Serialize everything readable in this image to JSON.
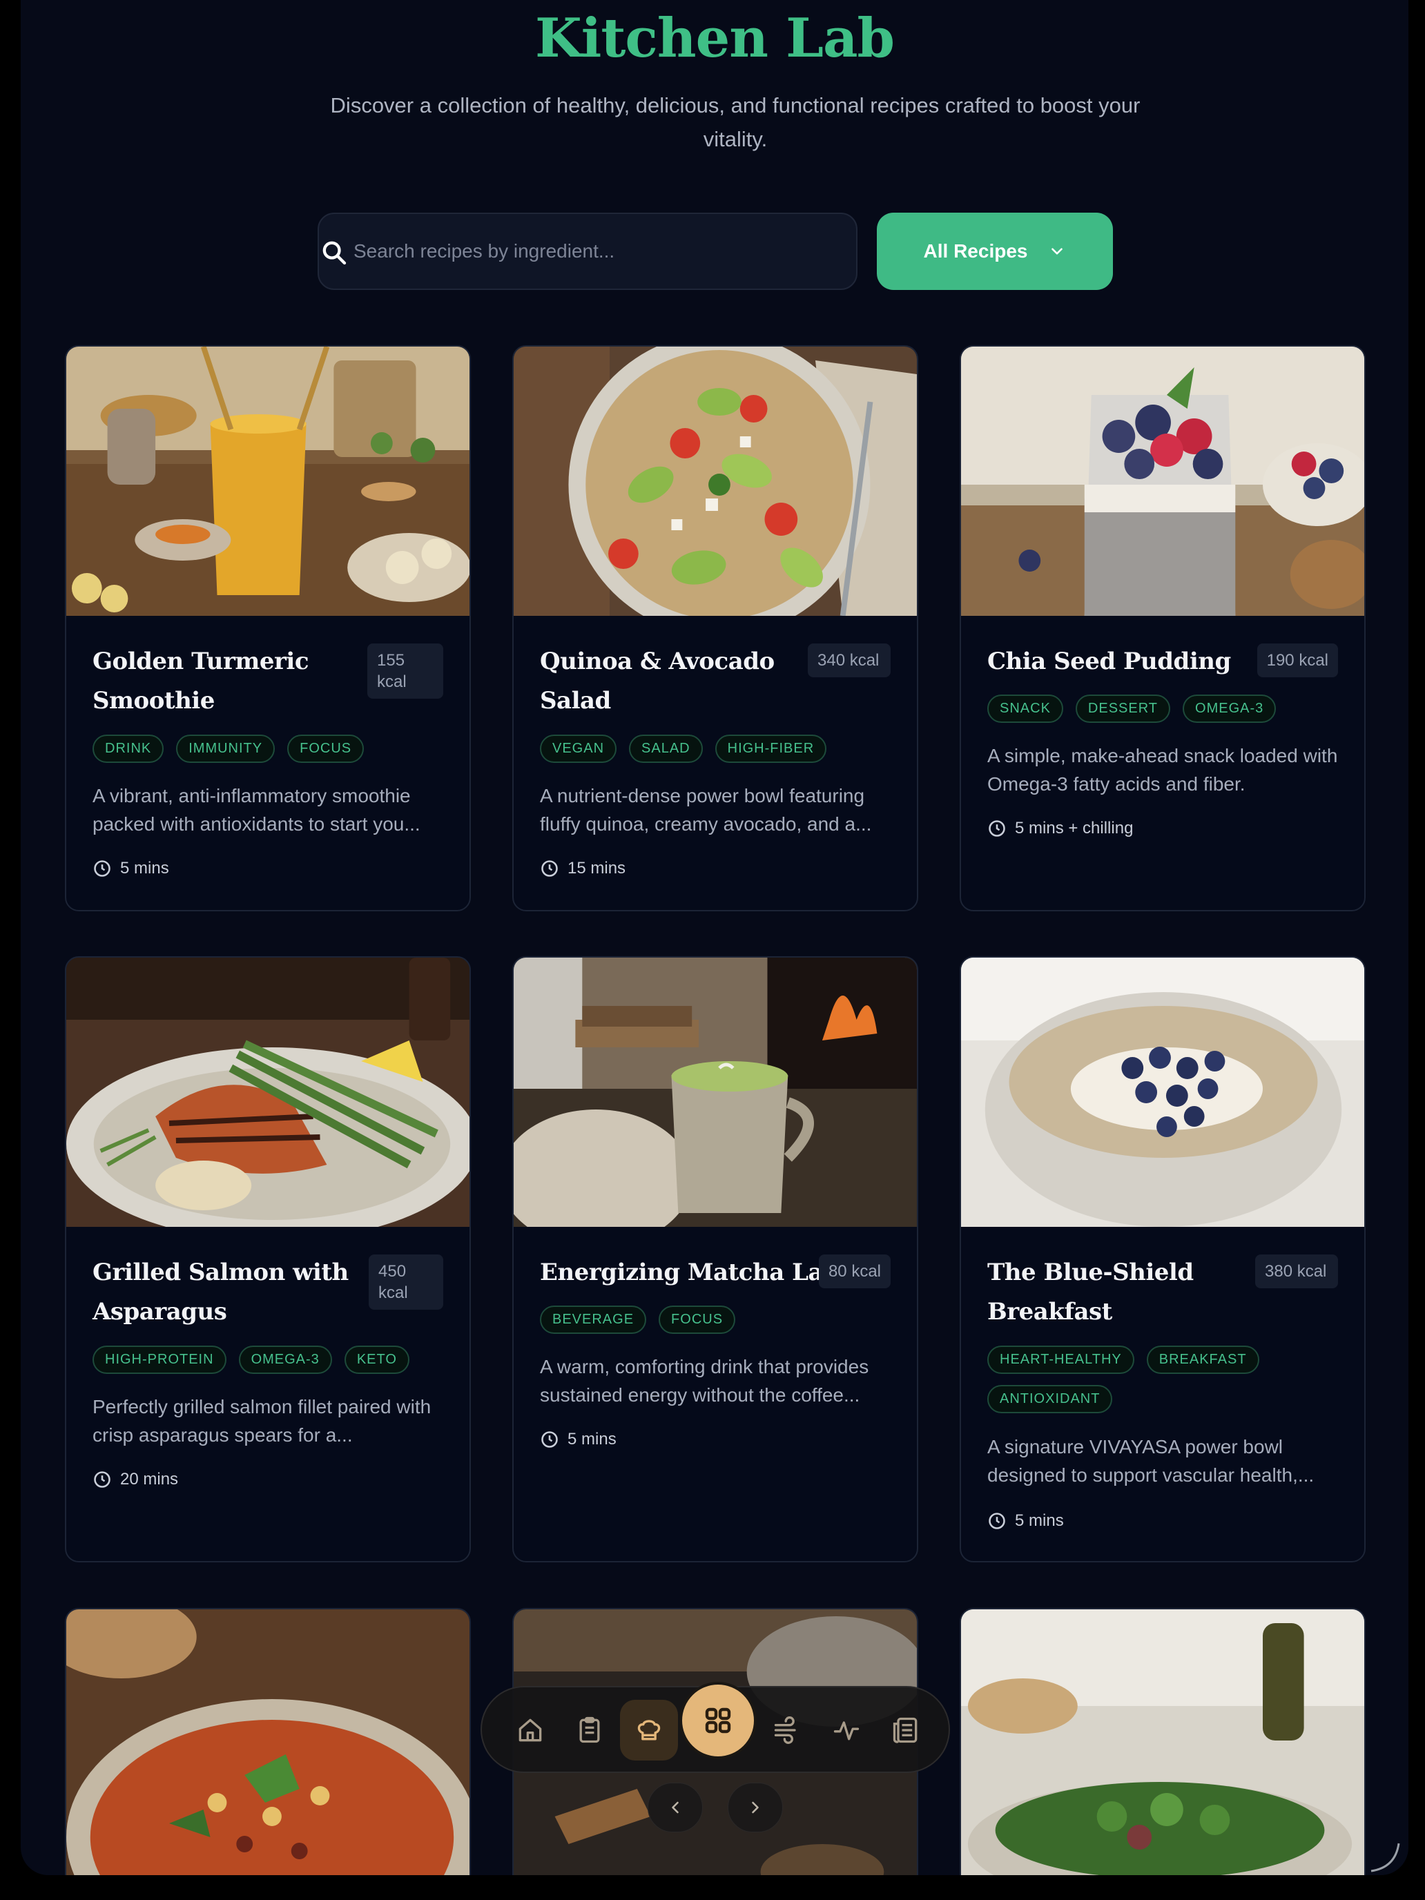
{
  "header": {
    "title": "Kitchen Lab",
    "subtitle": "Discover a collection of healthy, delicious, and functional recipes crafted to boost your vitality."
  },
  "search": {
    "placeholder": "Search recipes by ingredient...",
    "value": ""
  },
  "filter": {
    "label": "All Recipes"
  },
  "recipes": [
    {
      "title": "Golden Turmeric Smoothie",
      "kcal": "155 kcal",
      "tags": [
        "DRINK",
        "IMMUNITY",
        "FOCUS"
      ],
      "desc": "A vibrant, anti-inflammatory smoothie packed with antioxidants to start you...",
      "time": "5 mins"
    },
    {
      "title": "Quinoa & Avocado Salad",
      "kcal": "340 kcal",
      "tags": [
        "VEGAN",
        "SALAD",
        "HIGH-FIBER"
      ],
      "desc": "A nutrient-dense power bowl featuring fluffy quinoa, creamy avocado, and a...",
      "time": "15 mins"
    },
    {
      "title": "Chia Seed Pudding",
      "kcal": "190 kcal",
      "tags": [
        "SNACK",
        "DESSERT",
        "OMEGA-3"
      ],
      "desc": "A simple, make-ahead snack loaded with Omega-3 fatty acids and fiber.",
      "time": "5 mins + chilling"
    },
    {
      "title": "Grilled Salmon with Asparagus",
      "kcal": "450 kcal",
      "tags": [
        "HIGH-PROTEIN",
        "OMEGA-3",
        "KETO"
      ],
      "desc": "Perfectly grilled salmon fillet paired with crisp asparagus spears for a...",
      "time": "20 mins"
    },
    {
      "title": "Energizing Matcha Latte",
      "kcal": "80 kcal",
      "tags": [
        "BEVERAGE",
        "FOCUS"
      ],
      "desc": "A warm, comforting drink that provides sustained energy without the coffee...",
      "time": "5 mins"
    },
    {
      "title": "The Blue-Shield Breakfast",
      "kcal": "380 kcal",
      "tags": [
        "HEART-HEALTHY",
        "BREAKFAST",
        "ANTIOXIDANT"
      ],
      "desc": "A signature VIVAYASA power bowl designed to support vascular health,...",
      "time": "5 mins"
    }
  ],
  "dock": {
    "items": [
      "home-icon",
      "clipboard-icon",
      "chef-hat-icon",
      "grid-icon",
      "wind-icon",
      "activity-icon",
      "newspaper-icon"
    ],
    "active": "grid-icon"
  },
  "colors": {
    "accent": "#3fba85",
    "title": "#3fbf86",
    "dock_highlight": "#e4b77a",
    "background": "#060a18"
  }
}
